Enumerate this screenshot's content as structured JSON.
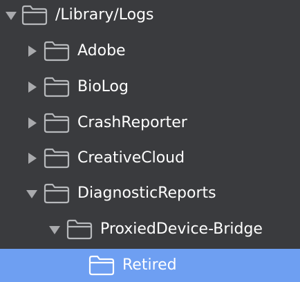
{
  "tree": {
    "rows": [
      {
        "label": "/Library/Logs",
        "expanded": true,
        "selected": false,
        "icon": "folder-icon",
        "toggle": "triangle-down-icon"
      },
      {
        "label": "Adobe",
        "expanded": false,
        "selected": false,
        "icon": "folder-icon",
        "toggle": "triangle-right-icon"
      },
      {
        "label": "BioLog",
        "expanded": false,
        "selected": false,
        "icon": "folder-icon",
        "toggle": "triangle-right-icon"
      },
      {
        "label": "CrashReporter",
        "expanded": false,
        "selected": false,
        "icon": "folder-icon",
        "toggle": "triangle-right-icon"
      },
      {
        "label": "CreativeCloud",
        "expanded": false,
        "selected": false,
        "icon": "folder-icon",
        "toggle": "triangle-right-icon"
      },
      {
        "label": "DiagnosticReports",
        "expanded": true,
        "selected": false,
        "icon": "folder-icon",
        "toggle": "triangle-down-icon"
      },
      {
        "label": "ProxiedDevice-Bridge",
        "expanded": true,
        "selected": false,
        "icon": "folder-icon",
        "toggle": "triangle-down-icon"
      },
      {
        "label": "Retired",
        "expanded": false,
        "selected": true,
        "icon": "folder-icon",
        "toggle": ""
      }
    ]
  },
  "colors": {
    "background": "#3a3b3e",
    "selection": "#6e9ff2",
    "text": "#ffffff",
    "disclosure": "#a9aaad",
    "folder_outline": "#b8babd",
    "folder_outline_selected": "#ffffff"
  }
}
